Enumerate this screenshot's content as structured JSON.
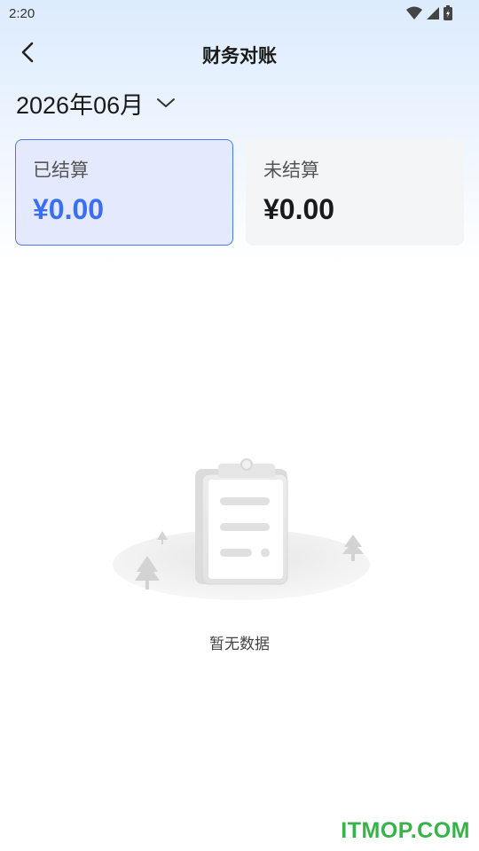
{
  "status_bar": {
    "time": "2:20",
    "icons": [
      "wifi-icon",
      "signal-icon",
      "battery-icon"
    ]
  },
  "header": {
    "title": "财务对账",
    "back_icon": "chevron-left-icon"
  },
  "month_picker": {
    "value": "2026年06月",
    "icon": "chevron-down-icon"
  },
  "cards": {
    "settled": {
      "label": "已结算",
      "amount": "¥0.00",
      "selected": true
    },
    "unsettled": {
      "label": "未结算",
      "amount": "¥0.00",
      "selected": false
    }
  },
  "empty_state": {
    "text": "暂无数据",
    "icon": "empty-clipboard-illustration"
  },
  "watermark": {
    "text": "ITMOP.COM"
  },
  "colors": {
    "accent": "#3a6ff4",
    "card_selected_bg": "#e4e9fd",
    "card_bg": "#f4f5f7",
    "watermark": "#37b34a"
  }
}
